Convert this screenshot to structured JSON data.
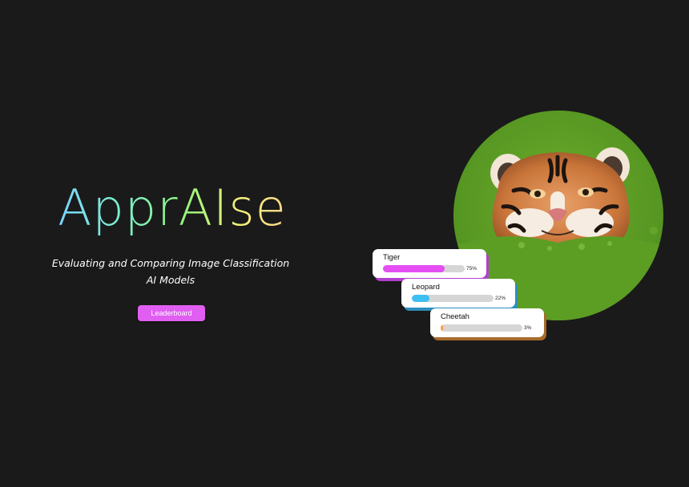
{
  "hero": {
    "title": "ApprAIse",
    "subtitle": "Evaluating and Comparing Image Classification AI Models",
    "button_label": "Leaderboard"
  },
  "predictions": [
    {
      "label": "Tiger",
      "percent_text": "75%",
      "fraction": 0.75,
      "color": "#e44ef2"
    },
    {
      "label": "Leopard",
      "percent_text": "22%",
      "fraction": 0.22,
      "color": "#3ebff2"
    },
    {
      "label": "Cheetah",
      "percent_text": "3%",
      "fraction": 0.03,
      "color": "#f2a14a"
    }
  ],
  "colors": {
    "background": "#1a1a1a",
    "button": "#e15ef2",
    "title_gradient": [
      "#78d4ff",
      "#7df0c8",
      "#92f57a",
      "#f4f07a",
      "#ffd88a"
    ]
  }
}
